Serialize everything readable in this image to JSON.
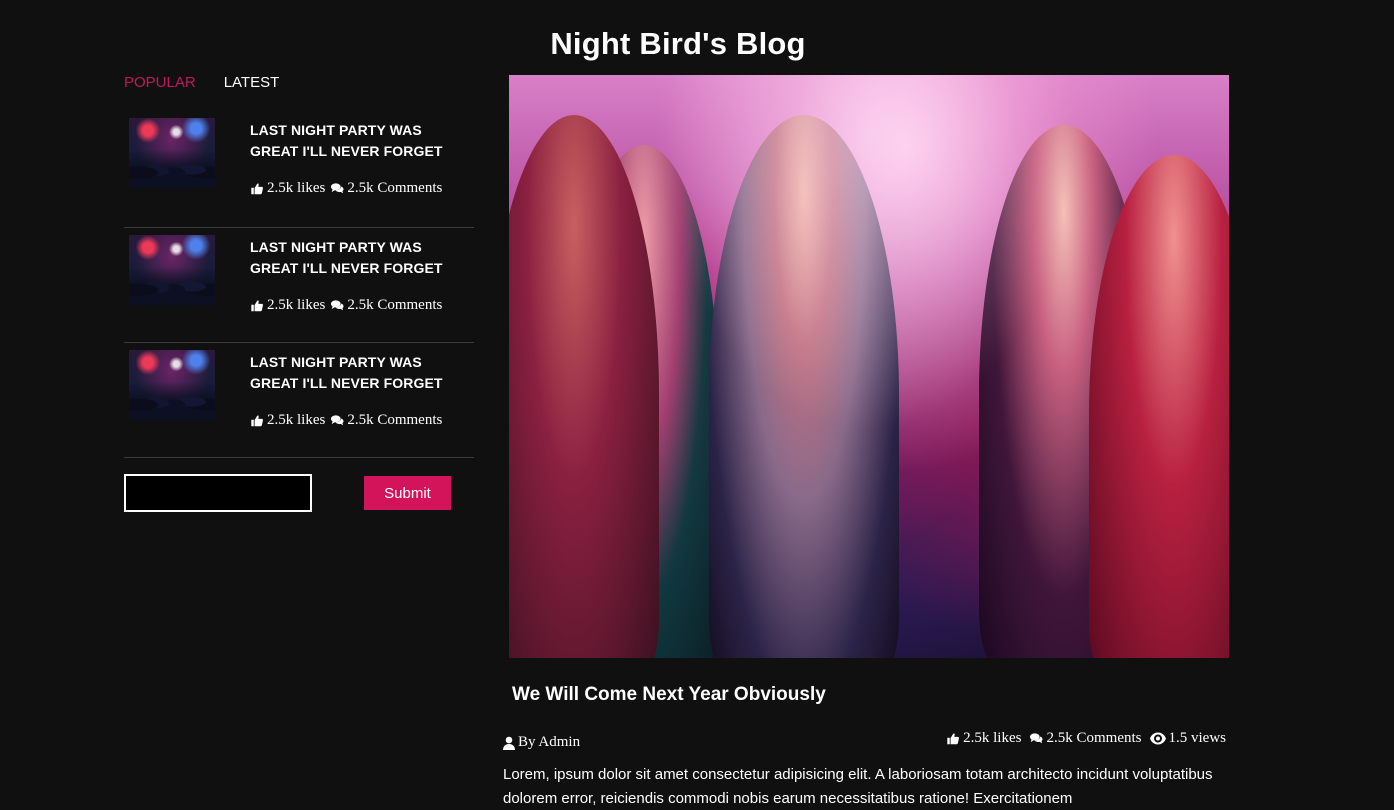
{
  "site": {
    "title": "Night Bird's Blog"
  },
  "sidebar": {
    "tabs": [
      {
        "label": "POPULAR",
        "active": true
      },
      {
        "label": "LATEST",
        "active": false
      }
    ],
    "posts": [
      {
        "title": "LAST NIGHT PARTY WAS GREAT I'LL NEVER FORGET",
        "likes": "2.5k likes",
        "comments": "2.5k Comments"
      },
      {
        "title": "LAST NIGHT PARTY WAS GREAT I'LL NEVER FORGET",
        "likes": "2.5k likes",
        "comments": "2.5k Comments"
      },
      {
        "title": "LAST NIGHT PARTY WAS GREAT I'LL NEVER FORGET",
        "likes": "2.5k likes",
        "comments": "2.5k Comments"
      }
    ],
    "subscribe": {
      "input_value": "",
      "submit_label": "Submit"
    }
  },
  "article": {
    "title": "We Will Come Next Year Obviously",
    "author": "By Admin",
    "likes": "2.5k likes",
    "comments": "2.5k Comments",
    "views": "1.5 views",
    "body": "Lorem, ipsum dolor sit amet consectetur adipisicing elit. A laboriosam totam architecto incidunt voluptatibus dolorem error, reiciendis commodi nobis earum necessitatibus ratione! Exercitationem"
  },
  "icons": {
    "like": "thumbs-up-icon",
    "comment": "comments-icon",
    "author": "user-icon",
    "views": "eye-icon"
  },
  "colors": {
    "background": "#101010",
    "accent": "#d4145a",
    "active_tab": "#c2185b",
    "text": "#ffffff",
    "divider": "#3b3b3b"
  }
}
